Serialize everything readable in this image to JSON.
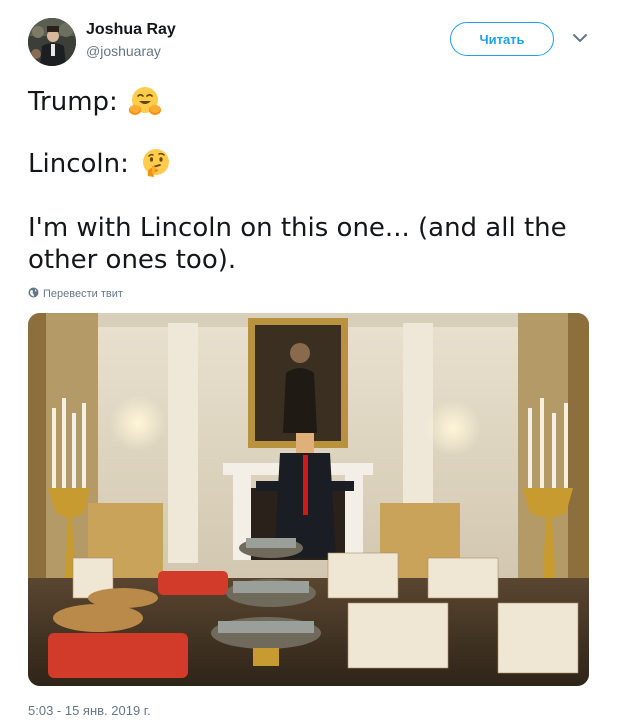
{
  "tweet": {
    "author_name": "Joshua Ray",
    "author_handle": "@joshuaray",
    "follow_label": "Читать",
    "line1": "Trump:",
    "line2": "Lincoln:",
    "line3": "I'm with Lincoln on this one... (and all the other ones too).",
    "translate_label": "Перевести твит",
    "timestamp": "5:03 - 15 янв. 2019 г."
  },
  "icons": {
    "line1_emoji": "hugging-face-emoji",
    "line2_emoji": "thinking-face-emoji",
    "caret": "chevron-down-icon",
    "translate": "globe-icon"
  },
  "colors": {
    "accent": "#1da1f2",
    "secondary_text": "#657786",
    "primary_text": "#14171a"
  }
}
